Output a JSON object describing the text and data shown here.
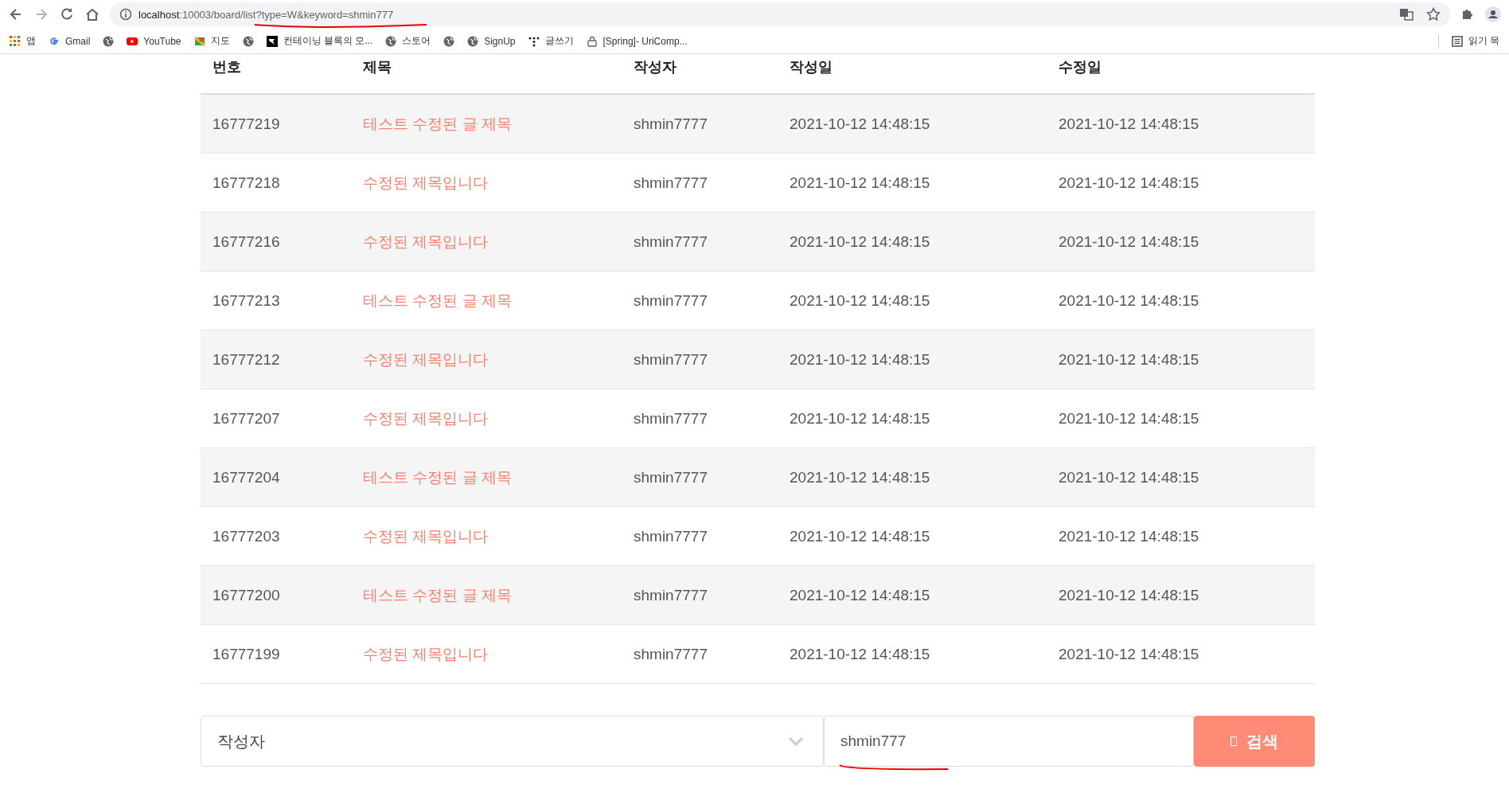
{
  "browser": {
    "url_host": "localhost",
    "url_rest": ":10003/board/list?type=W&keyword=shmin777",
    "bookmarks": [
      {
        "kind": "apps",
        "label": "앱"
      },
      {
        "kind": "google",
        "label": "Gmail"
      },
      {
        "kind": "globe"
      },
      {
        "kind": "youtube",
        "label": "YouTube"
      },
      {
        "kind": "maps",
        "label": "지도"
      },
      {
        "kind": "globe"
      },
      {
        "kind": "square",
        "label": "컨테이닝 블록의 모..."
      },
      {
        "kind": "globe",
        "label": "스토어"
      },
      {
        "kind": "globe"
      },
      {
        "kind": "globe",
        "label": "SignUp"
      },
      {
        "kind": "dots",
        "label": "글쓰기"
      },
      {
        "kind": "lock",
        "label": "[Spring]- UriComp..."
      }
    ],
    "reading_list": "읽기 목"
  },
  "table": {
    "columns": [
      "번호",
      "제목",
      "작성자",
      "작성일",
      "수정일"
    ],
    "rows": [
      {
        "no": "16777219",
        "title": "테스트 수정된 글 제목",
        "writer": "shmin7777",
        "created": "2021-10-12 14:48:15",
        "updated": "2021-10-12 14:48:15"
      },
      {
        "no": "16777218",
        "title": "수정된 제목입니다",
        "writer": "shmin7777",
        "created": "2021-10-12 14:48:15",
        "updated": "2021-10-12 14:48:15"
      },
      {
        "no": "16777216",
        "title": "수정된 제목입니다",
        "writer": "shmin7777",
        "created": "2021-10-12 14:48:15",
        "updated": "2021-10-12 14:48:15"
      },
      {
        "no": "16777213",
        "title": "테스트 수정된 글 제목",
        "writer": "shmin7777",
        "created": "2021-10-12 14:48:15",
        "updated": "2021-10-12 14:48:15"
      },
      {
        "no": "16777212",
        "title": "수정된 제목입니다",
        "writer": "shmin7777",
        "created": "2021-10-12 14:48:15",
        "updated": "2021-10-12 14:48:15"
      },
      {
        "no": "16777207",
        "title": "수정된 제목입니다",
        "writer": "shmin7777",
        "created": "2021-10-12 14:48:15",
        "updated": "2021-10-12 14:48:15"
      },
      {
        "no": "16777204",
        "title": "테스트 수정된 글 제목",
        "writer": "shmin7777",
        "created": "2021-10-12 14:48:15",
        "updated": "2021-10-12 14:48:15"
      },
      {
        "no": "16777203",
        "title": "수정된 제목입니다",
        "writer": "shmin7777",
        "created": "2021-10-12 14:48:15",
        "updated": "2021-10-12 14:48:15"
      },
      {
        "no": "16777200",
        "title": "테스트 수정된 글 제목",
        "writer": "shmin7777",
        "created": "2021-10-12 14:48:15",
        "updated": "2021-10-12 14:48:15"
      },
      {
        "no": "16777199",
        "title": "수정된 제목입니다",
        "writer": "shmin7777",
        "created": "2021-10-12 14:48:15",
        "updated": "2021-10-12 14:48:15"
      }
    ]
  },
  "search": {
    "type": "작성자",
    "keyword": "shmin777",
    "button": "검색"
  }
}
